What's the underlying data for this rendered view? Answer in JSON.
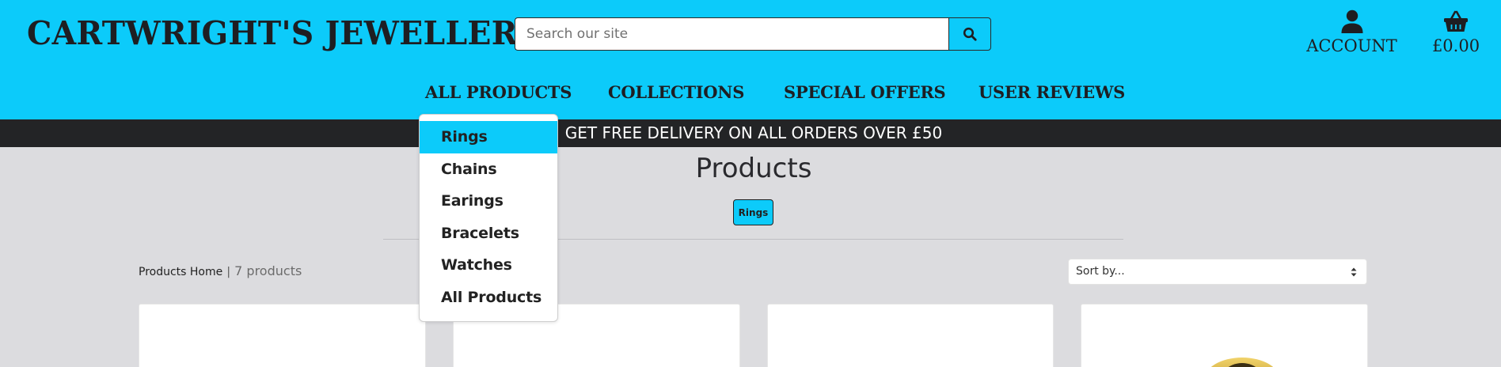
{
  "header": {
    "brand": "CARTWRIGHT'S JEWELLERY",
    "search": {
      "placeholder": "Search our site",
      "value": ""
    },
    "account_label": "ACCOUNT",
    "basket_total": "£0.00"
  },
  "nav": {
    "items": [
      "ALL PRODUCTS",
      "COLLECTIONS",
      "SPECIAL OFFERS",
      "USER REVIEWS"
    ]
  },
  "dropdown": {
    "items": [
      "Rings",
      "Chains",
      "Earings",
      "Bracelets",
      "Watches",
      "All Products"
    ],
    "active": "Rings"
  },
  "banner": {
    "text": "GET FREE DELIVERY ON ALL ORDERS OVER £50"
  },
  "main": {
    "title": "Products",
    "active_tag": "Rings",
    "breadcrumb_home": "Products Home",
    "separator": "|",
    "count": "7 products",
    "sort_placeholder": "Sort by..."
  },
  "colors": {
    "accent": "#0ccbfa",
    "banner": "#232426",
    "page_bg": "#dcdcdf",
    "text_dark": "#1e1e22"
  },
  "icons": [
    "search-icon",
    "user-icon",
    "basket-icon",
    "sort-arrows-icon"
  ]
}
